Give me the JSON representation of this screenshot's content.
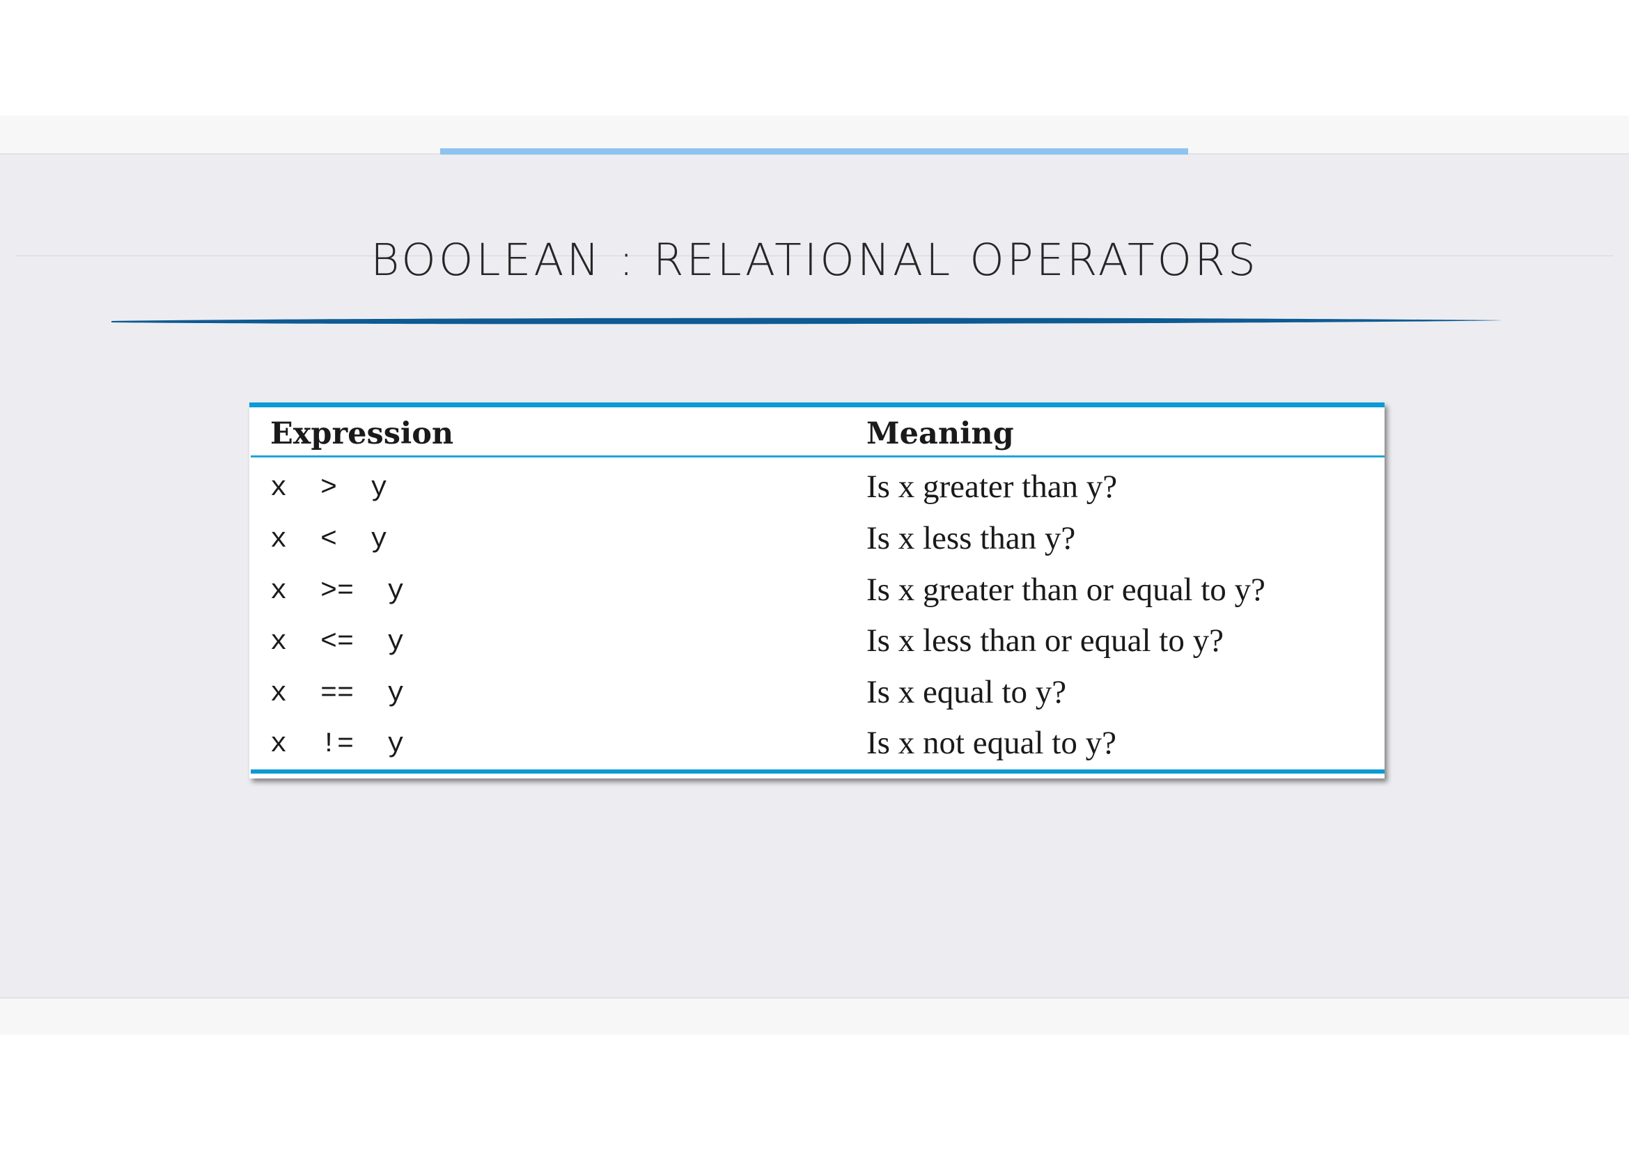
{
  "slide": {
    "title": "BOOLEAN : RELATIONAL OPERATORS"
  },
  "colors": {
    "slide_background": "#ededf1",
    "accent_bar": "#8ec2f0",
    "title_underline": "#0e5a93",
    "table_rule": "#0a9ad5",
    "text": "#1a1a1a"
  },
  "table": {
    "headers": {
      "expression": "Expression",
      "meaning": "Meaning"
    },
    "rows": [
      {
        "expression": "x  >  y",
        "meaning": "Is x greater than y?"
      },
      {
        "expression": "x  <  y",
        "meaning": "Is x less than y?"
      },
      {
        "expression": "x  >=  y",
        "meaning": "Is x greater than or equal to y?"
      },
      {
        "expression": "x  <=  y",
        "meaning": "Is x less than or equal to y?"
      },
      {
        "expression": "x  ==  y",
        "meaning": "Is x equal to y?"
      },
      {
        "expression": "x  !=  y",
        "meaning": "Is x not equal to y?"
      }
    ]
  }
}
